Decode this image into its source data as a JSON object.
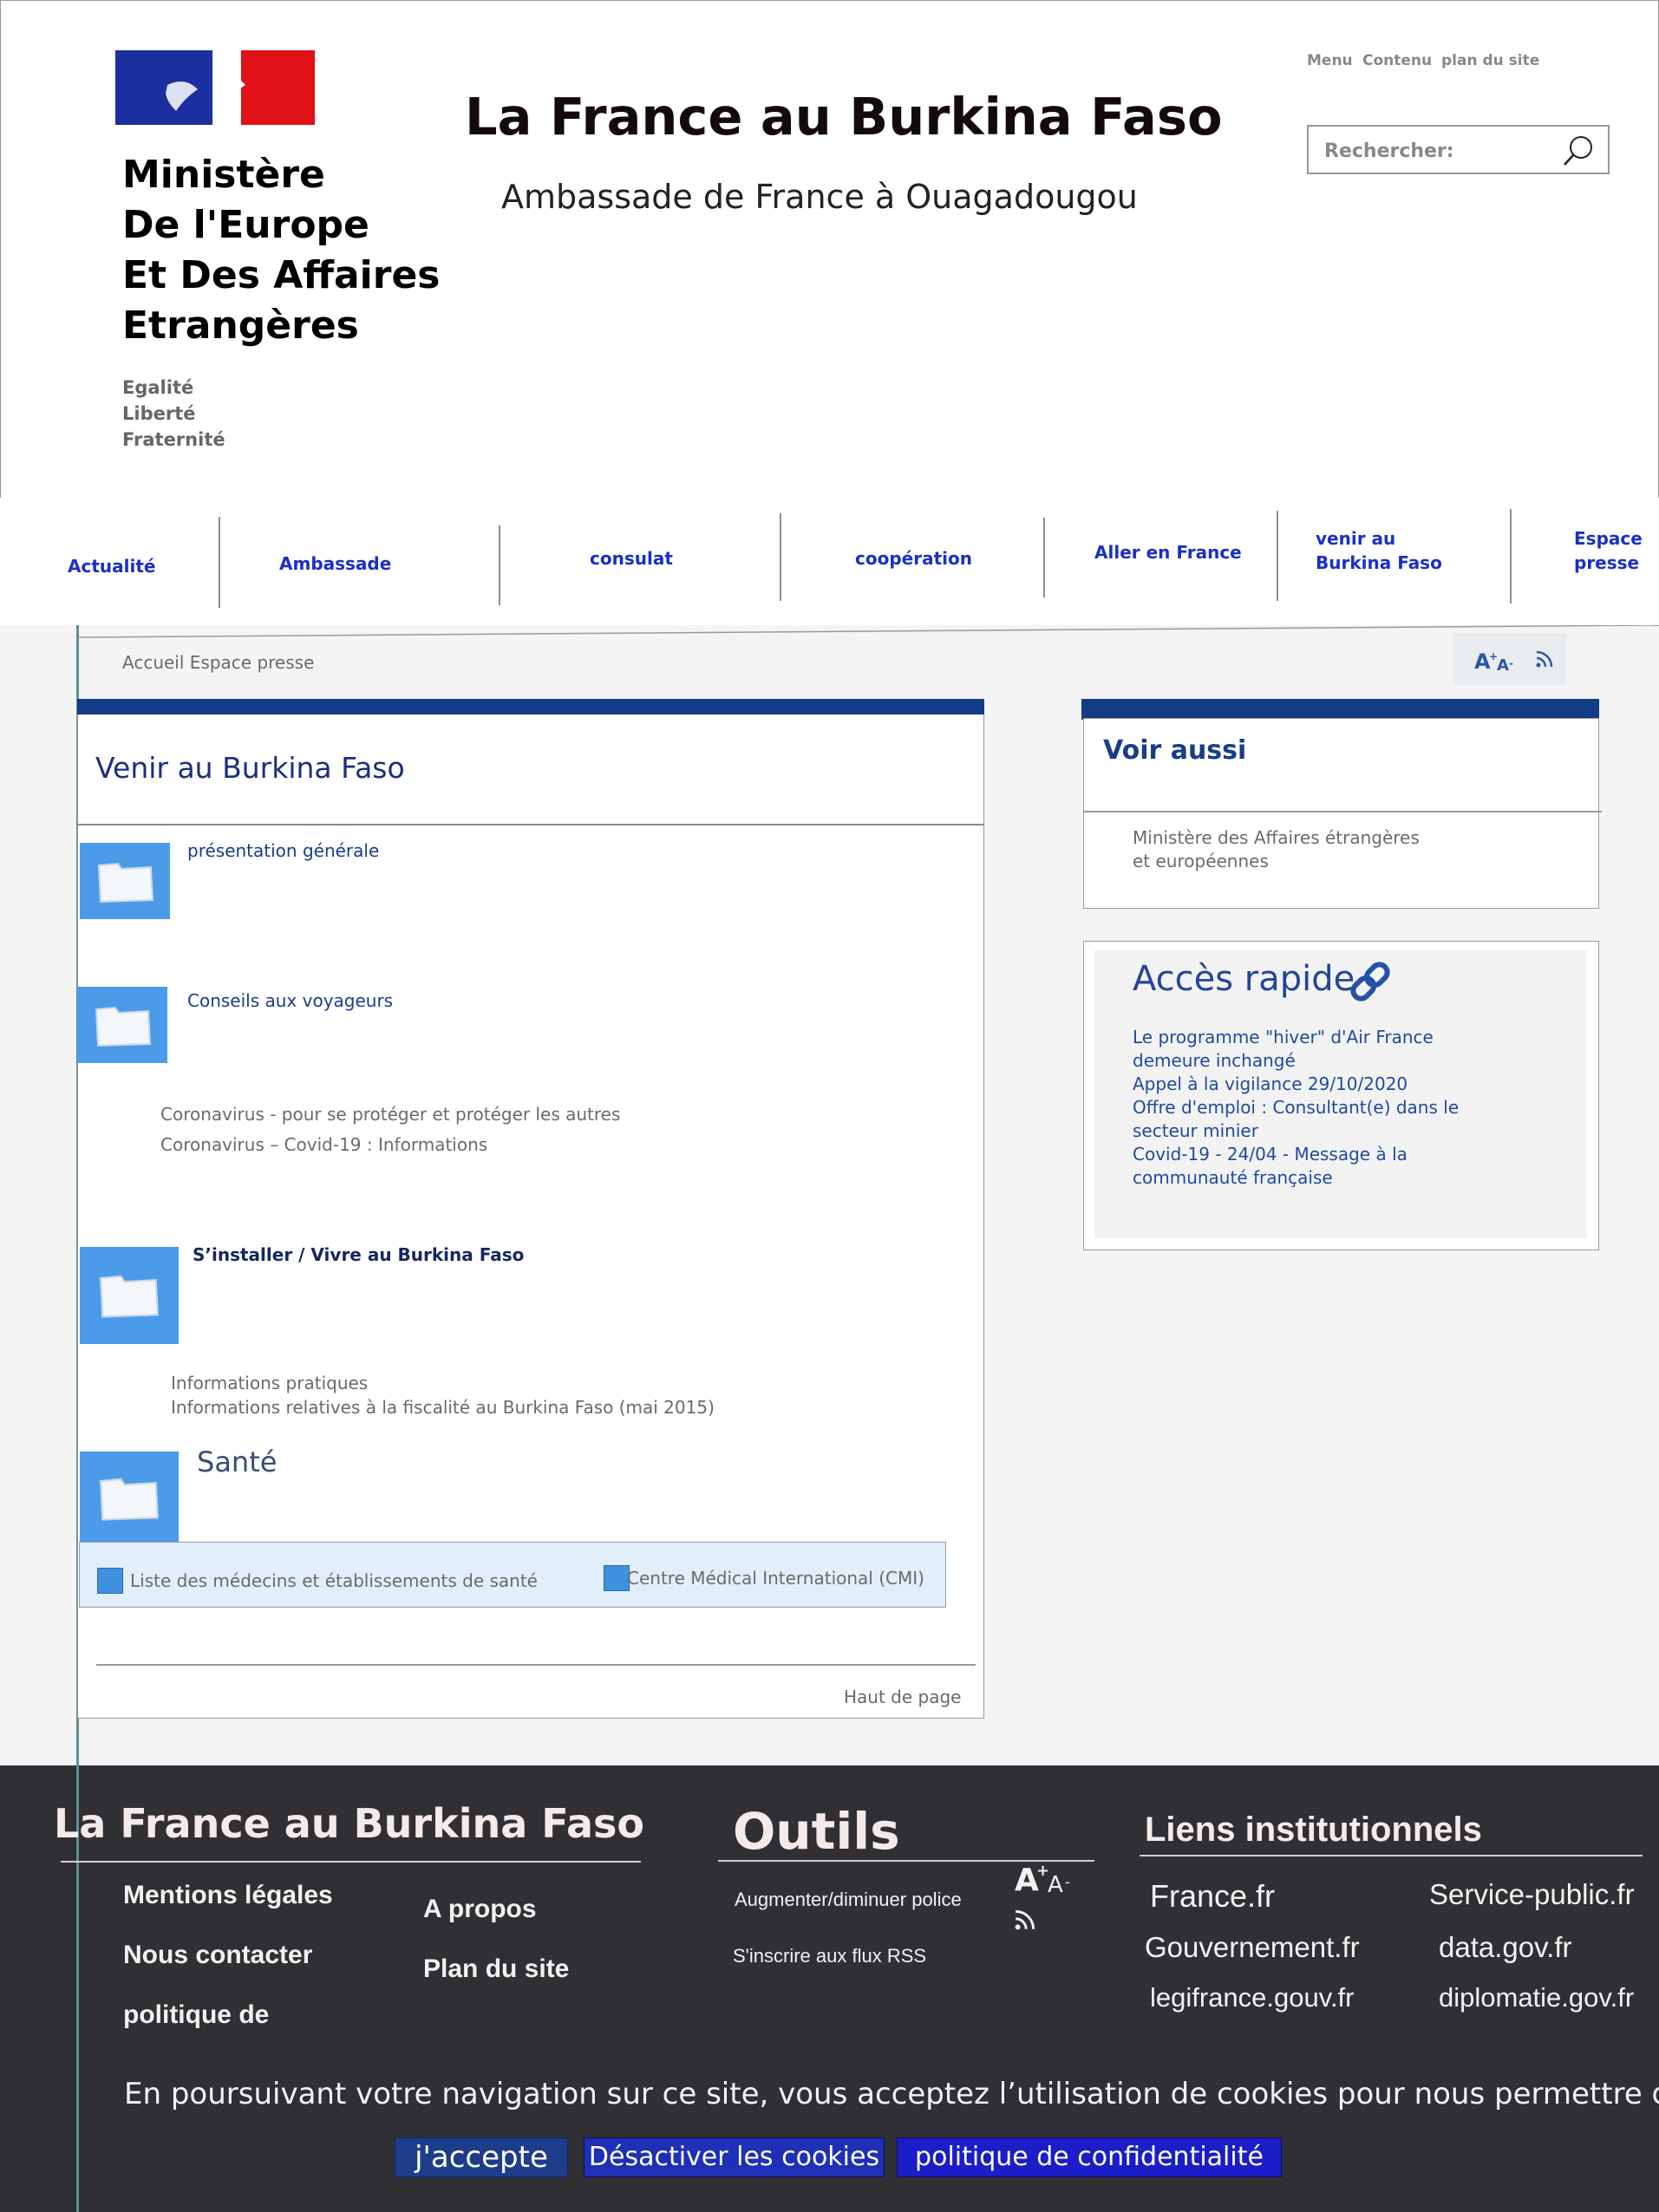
{
  "header": {
    "ministry_lines": [
      "Ministère",
      "De l'Europe",
      "Et Des Affaires",
      "Etrangères"
    ],
    "motto": [
      "Egalité",
      "Liberté",
      "Fraternité"
    ],
    "site_title": "La France au Burkina Faso",
    "site_subtitle": "Ambassade de France à Ouagadougou",
    "top_links": [
      "Menu",
      "Contenu",
      "plan du site"
    ],
    "search_placeholder": "Rechercher:",
    "flag_colors": {
      "blue": "#1b2f9e",
      "red": "#e01218"
    }
  },
  "nav": {
    "items": [
      {
        "label": "Actualité"
      },
      {
        "label": "Ambassade"
      },
      {
        "label": "consulat"
      },
      {
        "label": "coopération"
      },
      {
        "label": "Aller en France"
      },
      {
        "label": "venir au Burkina Faso"
      },
      {
        "label": "Espace presse"
      }
    ],
    "venir_lines": [
      "venir au",
      "Burkina Faso"
    ],
    "presse_lines": [
      "Espace",
      "presse"
    ]
  },
  "breadcrumb": "Accueil Espace presse",
  "tools": {
    "font_size_icon": "text-size-icon",
    "rss_icon": "rss-icon"
  },
  "main": {
    "title": "Venir au Burkina Faso",
    "sections": [
      {
        "title": "présentation générale",
        "links": []
      },
      {
        "title": "Conseils aux voyageurs",
        "links": [
          "Coronavirus - pour se protéger et protéger les autres",
          "Coronavirus – Covid-19 : Informations"
        ]
      },
      {
        "title": "S’installer / Vivre au Burkina Faso",
        "links": [
          "Informations pratiques",
          "Informations relatives à la fiscalité au Burkina Faso (mai 2015)"
        ]
      },
      {
        "title": "Santé",
        "links": [
          "Liste des médecins et établissements de santé",
          "Centre Médical International (CMI)"
        ]
      }
    ],
    "back_to_top": "Haut de page"
  },
  "aside": {
    "voir_aussi": {
      "title": "Voir aussi",
      "link": "Ministère des Affaires étrangères et européennes"
    },
    "acces_rapide": {
      "title": "Accès rapide",
      "links": [
        "Le programme \"hiver\" d'Air France demeure inchangé",
        "Appel à la vigilance 29/10/2020",
        "Offre d'emploi : Consultant(e) dans le secteur minier",
        "Covid-19 - 24/04 - Message à la communauté française"
      ]
    }
  },
  "footer": {
    "col1": {
      "title": "La France au Burkina Faso",
      "links_left": [
        "Mentions légales",
        "Nous contacter",
        "politique de"
      ],
      "links_right": [
        "A propos",
        "Plan du site"
      ]
    },
    "col2": {
      "title": "Outils",
      "items": [
        "Augmenter/diminuer police",
        "S'inscrire aux flux RSS"
      ]
    },
    "col3": {
      "title": "Liens institutionnels",
      "links": [
        "France.fr",
        "Service-public.fr",
        "Gouvernement.fr",
        "data.gov.fr",
        "legifrance.gouv.fr",
        "diplomatie.gov.fr"
      ]
    },
    "cookie_text": "En poursuivant votre navigation sur ce site, vous acceptez l’utilisation de cookies pour nous permettre de",
    "buttons": {
      "accept": "j'accepte",
      "disable": "Désactiver les cookies",
      "policy": "politique de confidentialité"
    }
  },
  "colors": {
    "nav_link": "#1a2fc8",
    "dark_blue": "#123c86",
    "folder_blue": "#4b9be8",
    "footer_bg": "#302f33"
  }
}
